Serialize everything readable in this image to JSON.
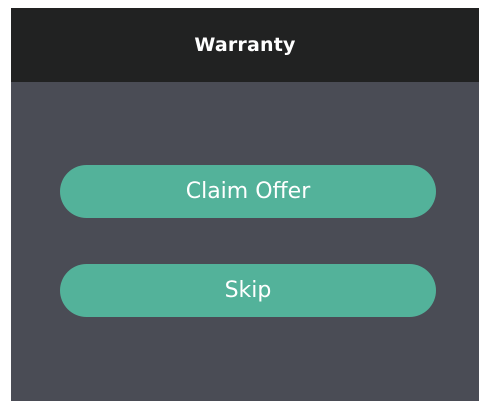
{
  "dialog": {
    "title": "Warranty",
    "buttons": {
      "claim_label": "Claim Offer",
      "skip_label": "Skip"
    }
  },
  "colors": {
    "header_bg": "#212222",
    "body_bg": "#4a4c55",
    "button_bg": "#53b29a",
    "text": "#ffffff"
  }
}
